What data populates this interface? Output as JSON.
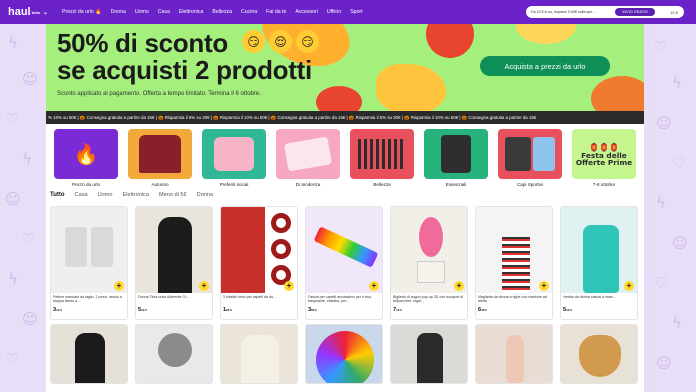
{
  "header": {
    "logo": "haul",
    "logo_sup": "beta",
    "nav": [
      "Prezzi da urlo 🔥",
      "Donna",
      "Uomo",
      "Casa",
      "Elettronica",
      "Bellezza",
      "Cucina",
      "Fai da te",
      "Accessori",
      "Ufficio",
      "Sport"
    ],
    "promo_text": "Da 15 € in su, risparmi 5,00€ sulla spe...",
    "promo_badge": "INVIO GRATIS",
    "promo_amount": "15 €"
  },
  "hero": {
    "title_line1": "50% di sconto",
    "title_line2": "se acquisti 2 prodotti",
    "subtitle": "Sconto applicato al pagamento. Offerta a tempo limitato. Termina il 6 ottobre.",
    "cta": "Acquista a prezzi da urlo",
    "emojis": [
      "😏",
      "😌",
      "😏"
    ]
  },
  "ticker": "% 10% su 50€  |  🎃 Consegna gratuita a partire da 15€  |  🎃 Risparmia il 5% su 30€  |  🎃 Risparmia il 10% su 50€  |  🎃 Consegna gratuita a partire da 15€  |  🎃 Risparmia il 5% su 30€  |  🎃 Risparmia il 10% su 50€  |  🎃 Consegna gratuita a partire da 15€",
  "categories": [
    {
      "label": "Prezzi da urlo",
      "icon": "flame-icon",
      "color": "#7b2bd6"
    },
    {
      "label": "Autunno",
      "icon": "sweater-icon",
      "color": "#f2a93b"
    },
    {
      "label": "Preferiti social",
      "icon": "social-icon",
      "color": "#2fb896"
    },
    {
      "label": "Di tendenza",
      "icon": "trend-icon",
      "color": "#f5a8c0"
    },
    {
      "label": "Bellezza",
      "icon": "brush-icon",
      "color": "#e8505b"
    },
    {
      "label": "Essenziali",
      "icon": "shirt-icon",
      "color": "#27b37e"
    },
    {
      "label": "Capi Sportivi",
      "icon": "tshirt-icon",
      "color": "#e8505b"
    },
    {
      "label": "7-8 ottobre",
      "icon": "festa-icon",
      "color": "#c5f58f",
      "festa": "Festa delle Offerte Prime"
    }
  ],
  "tabs": [
    "Tutto",
    "Casa",
    "Uomo",
    "Elettronica",
    "Meno di 5€",
    "Donna"
  ],
  "products": [
    {
      "title": "Pettine manuale da taglio, 2 pezzi, rasoio a doppia faccia a ...",
      "price": "3",
      "cents": "12 €",
      "bg": "#efefef"
    },
    {
      "title": "Donna Tinta unita Aderente Cr...",
      "price": "5",
      "cents": "13 €",
      "bg": "#e9e4dc"
    },
    {
      "title": "3 elastici rossi per capelli da do...",
      "price": "1",
      "cents": "80 €",
      "bg": "#b52d2d"
    },
    {
      "title": "Fascia per capelli arcobaleno per il viso, traspirante, elastica, per...",
      "price": "3",
      "cents": "80 €",
      "bg": "#f0e8f8"
    },
    {
      "title": "Biglietto di auguri pop-up 3D con bouquet di tulipani finti, regal...",
      "price": "7",
      "cents": "13 €",
      "bg": "#f2efe9"
    },
    {
      "title": "Maglietta da donna a righe con maniche ad aletta",
      "price": "6",
      "cents": "49 €",
      "bg": "#f4f4f4"
    },
    {
      "title": "Vestito da donna casual a mani...",
      "price": "5",
      "cents": "13 €",
      "bg": "#dff1f1"
    }
  ],
  "products_row2": [
    {
      "bg": "#e6e1d8"
    },
    {
      "bg": "#e9e9e9"
    },
    {
      "bg": "#ebe4d8"
    },
    {
      "bg": "#c8d7ea"
    },
    {
      "bg": "#dcdad6"
    },
    {
      "bg": "#e9dcd4"
    },
    {
      "bg": "#e8e1d6"
    }
  ]
}
